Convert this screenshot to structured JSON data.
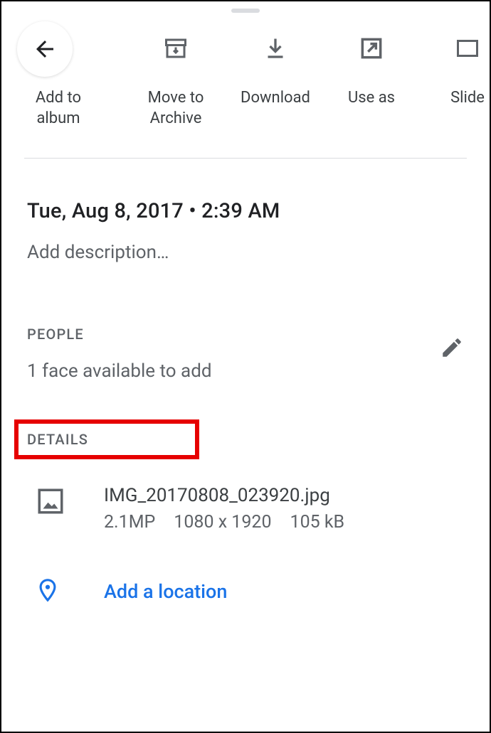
{
  "actions": [
    {
      "label": "Add to\nalbum"
    },
    {
      "label": "Move to\nArchive"
    },
    {
      "label": "Download"
    },
    {
      "label": "Use as"
    },
    {
      "label": "Slide"
    }
  ],
  "datetime": "Tue, Aug 8, 2017  •  2:39 AM",
  "description_placeholder": "Add description…",
  "people": {
    "label": "PEOPLE",
    "value": "1 face available to add"
  },
  "details": {
    "label": "DETAILS",
    "filename": "IMG_20170808_023920.jpg",
    "megapixels": "2.1MP",
    "resolution": "1080 x 1920",
    "filesize": "105 kB"
  },
  "location": {
    "add_label": "Add a location"
  }
}
